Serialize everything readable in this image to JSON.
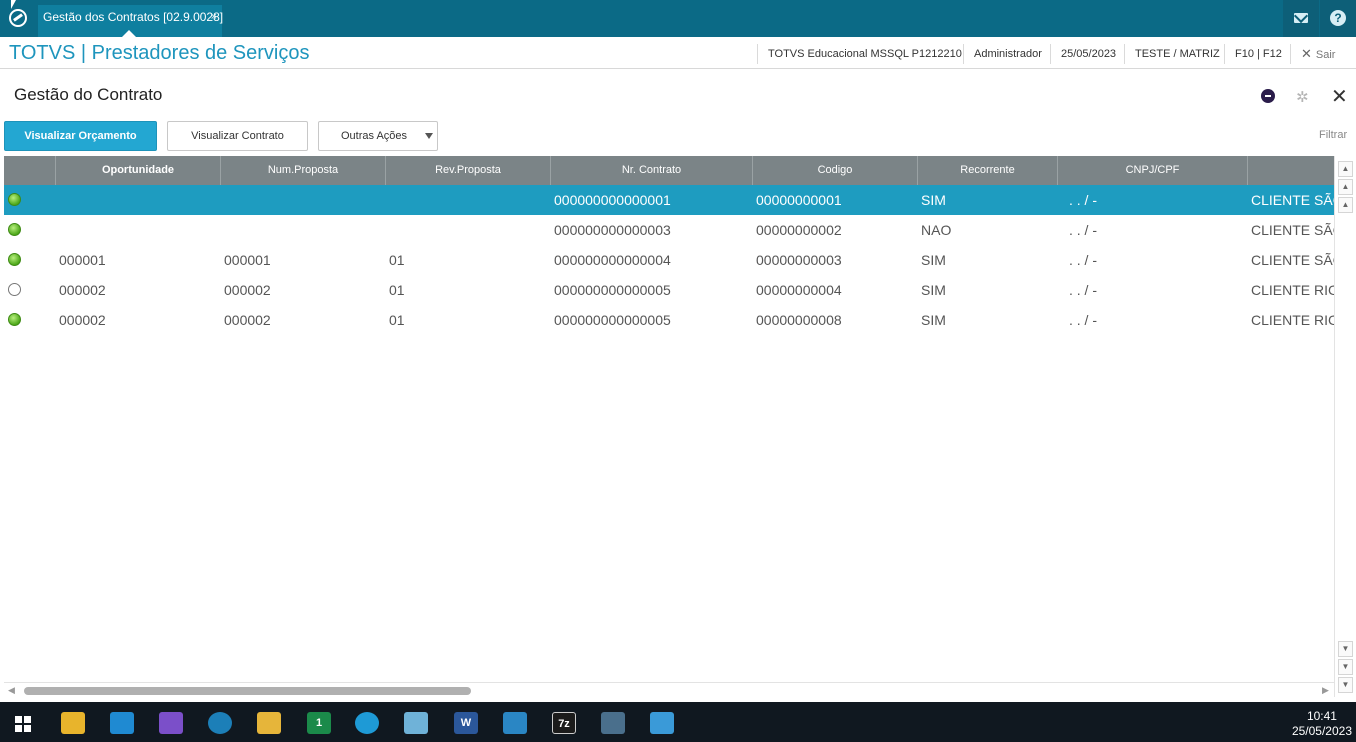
{
  "tab": {
    "title": "Gestão dos Contratos [02.9.0028]",
    "close": "×"
  },
  "topbar": {
    "help_glyph": "?"
  },
  "header": {
    "brand": "TOTVS | Prestadores de Serviços",
    "company": "TOTVS Educacional MSSQL P1212210",
    "user": "Administrador",
    "date": "25/05/2023",
    "branch": "TESTE / MATRIZ",
    "keys": "F10 | F12",
    "exit_label": "Sair",
    "exit_glyph": "✕"
  },
  "page": {
    "title": "Gestão do Contrato",
    "close_glyph": "✕",
    "gear_glyph": "✲"
  },
  "toolbar": {
    "primary_label": "Visualizar Orçamento",
    "contract_label": "Visualizar Contrato",
    "more_label": "Outras Ações",
    "filter_label": "Filtrar"
  },
  "grid": {
    "columns": [
      "",
      "Oportunidade",
      "Num.Proposta",
      "Rev.Proposta",
      "Nr. Contrato",
      "Codigo",
      "Recorrente",
      "CNPJ/CPF",
      ""
    ],
    "rows": [
      {
        "status": "green",
        "oportunidade": "",
        "num_proposta": "",
        "rev_proposta": "",
        "nr_contrato": "000000000000001",
        "codigo": "00000000001",
        "recorrente": "SIM",
        "cnpj": ". .  /   -",
        "cliente": "CLIENTE SÃO"
      },
      {
        "status": "green",
        "oportunidade": "",
        "num_proposta": "",
        "rev_proposta": "",
        "nr_contrato": "000000000000003",
        "codigo": "00000000002",
        "recorrente": "NAO",
        "cnpj": ". .  /   -",
        "cliente": "CLIENTE SÃO"
      },
      {
        "status": "green",
        "oportunidade": "000001",
        "num_proposta": "000001",
        "rev_proposta": "01",
        "nr_contrato": "000000000000004",
        "codigo": "00000000003",
        "recorrente": "SIM",
        "cnpj": ". .  /   -",
        "cliente": "CLIENTE SÃO"
      },
      {
        "status": "white",
        "oportunidade": "000002",
        "num_proposta": "000002",
        "rev_proposta": "01",
        "nr_contrato": "000000000000005",
        "codigo": "00000000004",
        "recorrente": "SIM",
        "cnpj": ". .  /   -",
        "cliente": "CLIENTE RIC"
      },
      {
        "status": "green",
        "oportunidade": "000002",
        "num_proposta": "000002",
        "rev_proposta": "01",
        "nr_contrato": "000000000000005",
        "codigo": "00000000008",
        "recorrente": "SIM",
        "cnpj": ". .  /   -",
        "cliente": "CLIENTE RIC"
      }
    ]
  },
  "taskbar": {
    "time": "10:41",
    "date": "25/05/2023",
    "sevenzip_label": "7z",
    "word_label": "W",
    "badge": "1"
  },
  "colors": {
    "topbar": "#0b6a86",
    "accent": "#23a7d2",
    "selected_row": "#1e9cc0",
    "grid_header": "#7b8487",
    "status_green": "#4ea81a"
  }
}
